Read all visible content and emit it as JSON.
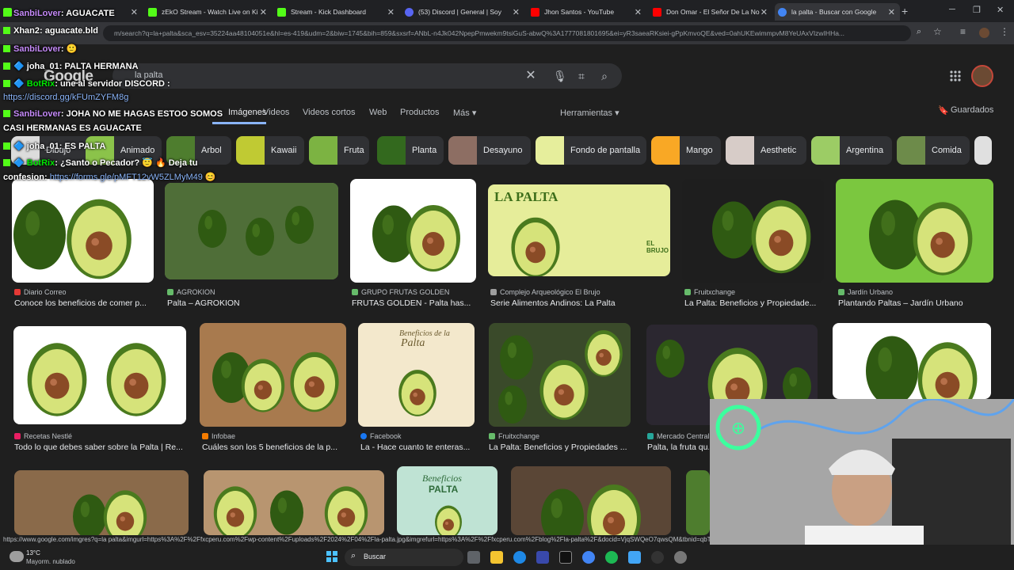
{
  "browser": {
    "tabs": [
      {
        "label": "",
        "color": "#53fc18"
      },
      {
        "label": "zEkO Stream - Watch Live on Ki",
        "color": "#53fc18"
      },
      {
        "label": "Stream - Kick Dashboard",
        "color": "#53fc18"
      },
      {
        "label": "(53) Discord | General | Soy",
        "color": "#5865f2"
      },
      {
        "label": "Jhon Santos - YouTube",
        "color": "#ff0000"
      },
      {
        "label": "Don Omar - El Señor De La No",
        "color": "#ff0000"
      },
      {
        "label": "la palta - Buscar con Google",
        "color": "#4285f4"
      }
    ],
    "url": "m/search?q=la+palta&sca_esv=35224aa48104051e&hl=es-419&udm=2&biw=1745&bih=859&sxsrf=ANbL-n4Jk042NpepPmwekm9tsiGuS-abwQ%3A1777081801695&ei=yR3saeaRKsiei-gPpKmvoQE&ved=0ahUKEwimmpvM8YeUAxVIzwIHHa..."
  },
  "google": {
    "logo": "Google",
    "query": "la palta",
    "nav_tabs": [
      "Imágenes",
      "Videos",
      "Videos cortos",
      "Web",
      "Productos",
      "Más ▾"
    ],
    "tools": "Herramientas ▾",
    "saved": "Guardados"
  },
  "chips": [
    "Dibujo",
    "Animado",
    "Arbol",
    "Kawaii",
    "Fruta",
    "Planta",
    "Desayuno",
    "Fondo de pantalla",
    "Mango",
    "Aesthetic",
    "Argentina",
    "Comida"
  ],
  "results_row1": [
    {
      "source": "Diario Correo",
      "caption": "Conoce los beneficios de comer p..."
    },
    {
      "source": "AGROKION",
      "caption": "Palta – AGROKION"
    },
    {
      "source": "GRUPO FRUTAS GOLDEN",
      "caption": "FRUTAS GOLDEN - Palta has..."
    },
    {
      "source": "Complejo Arqueológico El Brujo",
      "caption": "Serie Alimentos Andinos: La Palta",
      "img_title": "LA PALTA",
      "img_brand": "EL BRUJO"
    },
    {
      "source": "Fruitxchange",
      "caption": "La Palta: Beneficios y Propiedade..."
    },
    {
      "source": "Jardín Urbano",
      "caption": "Plantando Paltas – Jardín Urbano"
    }
  ],
  "results_row2": [
    {
      "source": "Recetas Nestlé",
      "caption": "Todo lo que debes saber sobre la Palta | Re..."
    },
    {
      "source": "Infobae",
      "caption": "Cuáles son los 5 beneficios de la p..."
    },
    {
      "source": "Facebook",
      "caption": "La - Hace cuanto te enteras...",
      "img_title_1": "Beneficios de la",
      "img_title_2": "Palta"
    },
    {
      "source": "Fruitxchange",
      "caption": "La Palta: Beneficios y Propiedades ..."
    },
    {
      "source": "Mercado Central",
      "caption": "Palta, la fruta qu..."
    }
  ],
  "results_row3": [
    {
      "img_title_1": "Beneficios",
      "img_title_2": "PALTA"
    }
  ],
  "status_url": "https://www.google.com/imgres?q=la palta&imgurl=https%3A%2F%2Ffxcperu.com%2Fwp-content%2Fuploads%2F2024%2F04%2Fla-palta.jpg&imgrefurl=https%3A%2F%2Ffxcperu.com%2Fblog%2Fla-palta%2F&docid=VjqSWQeO7qwsQM&tbnid=qbTF",
  "chat": [
    {
      "user": "SanbiLover",
      "message": ": AGUACATE",
      "user_color": "#c58af9"
    },
    {
      "user": "Xhan2",
      "message": ": aguacate.bld",
      "user_color": "#ffffff"
    },
    {
      "user": "SanbiLover",
      "message": ":",
      "user_color": "#c58af9"
    },
    {
      "user": "joha_01",
      "message": ": PALTA HERMANA",
      "user_color": "#ffffff"
    },
    {
      "user": "BotRix",
      "message": ": une al servidor DISCORD :",
      "user_color": "#00e701"
    },
    {
      "link": "https://discord.gg/kFUmZYFM8g"
    },
    {
      "user": "SanbiLover",
      "message": ": JOHA NO ME HAGAS ESTOO SOMOS",
      "user_color": "#c58af9"
    },
    {
      "message": "CASI HERMANAS ES AGUACATE"
    },
    {
      "user": "joha_01",
      "message": ": ES PALTA",
      "user_color": "#ffffff"
    },
    {
      "user": "BotRix",
      "message": ": ¿Santo o Pecador? 😇 🔥 Deja tu",
      "user_color": "#00e701"
    },
    {
      "message": "confesion:",
      "link": "https://forms.gle/pMFT12vW5ZLMyM49"
    }
  ],
  "taskbar": {
    "weather_temp": "13°C",
    "weather_desc": "Mayorm. nublado",
    "search": "Buscar"
  },
  "webcam": {
    "sign": "⊕"
  }
}
